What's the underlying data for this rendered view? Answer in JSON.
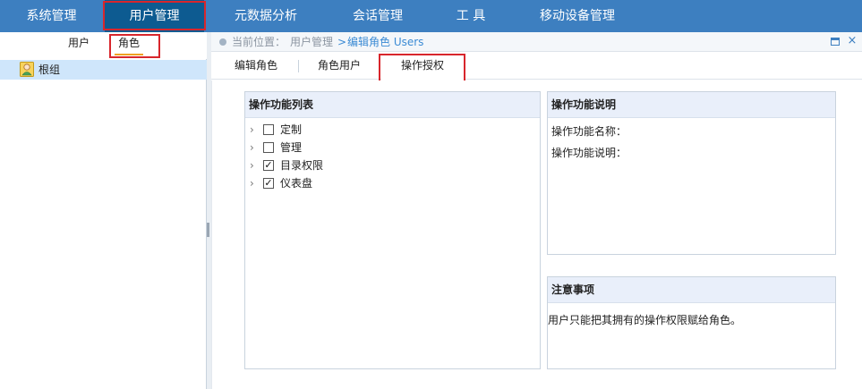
{
  "topnav": {
    "items": [
      {
        "label": "系统管理"
      },
      {
        "label": "用户管理"
      },
      {
        "label": "元数据分析"
      },
      {
        "label": "会话管理"
      },
      {
        "label": "工 具"
      },
      {
        "label": "移动设备管理"
      }
    ],
    "active_index": 1,
    "accent_color": "#3d7fc0",
    "active_color": "#0d5b91"
  },
  "left": {
    "subtabs": [
      {
        "label": "用户"
      },
      {
        "label": "角色"
      }
    ],
    "active_subtab": 1,
    "tree": [
      {
        "label": "根组",
        "icon": "user-icon",
        "selected": true
      }
    ]
  },
  "breadcrumb": {
    "prefix": "当前位置：",
    "items": [
      "用户管理",
      ">",
      "编辑角色 Users"
    ],
    "maximize_icon": "maximize-icon",
    "close_icon": "close-icon",
    "close_glyph": "×"
  },
  "tabs": [
    {
      "label": "编辑角色"
    },
    {
      "label": "角色用户"
    },
    {
      "label": "操作授权"
    }
  ],
  "active_tab": 2,
  "func_panel": {
    "title": "操作功能列表",
    "items": [
      {
        "label": "定制",
        "checked": false,
        "check_glyph": ""
      },
      {
        "label": "管理",
        "checked": false,
        "check_glyph": ""
      },
      {
        "label": "目录权限",
        "checked": true,
        "check_glyph": "✓"
      },
      {
        "label": "仪表盘",
        "checked": true,
        "check_glyph": "✓"
      }
    ]
  },
  "desc_panel": {
    "title": "操作功能说明",
    "name_label": "操作功能名称：",
    "desc_label": "操作功能说明："
  },
  "notes_panel": {
    "title": "注意事项",
    "text": "用户只能把其拥有的操作权限赋给角色。"
  },
  "highlight_color": "#d8262c"
}
